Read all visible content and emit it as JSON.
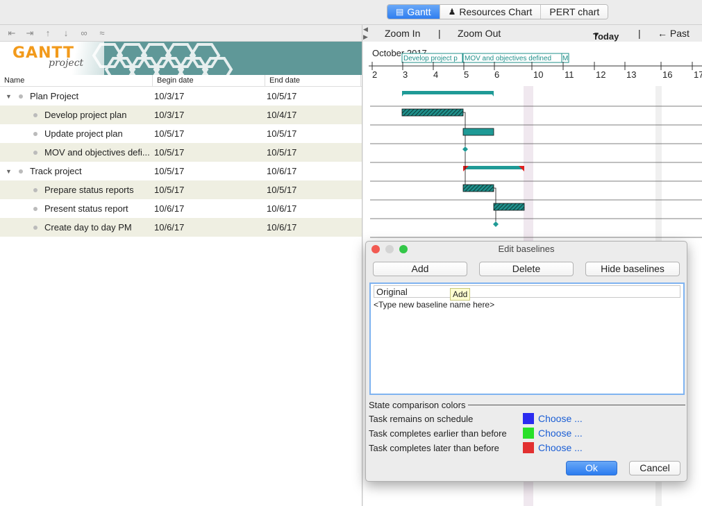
{
  "tabs": [
    {
      "label": "Gantt",
      "icon": "gantt-icon"
    },
    {
      "label": "Resources Chart",
      "icon": "resources-icon"
    },
    {
      "label": "PERT chart",
      "icon": ""
    }
  ],
  "toolbar": {
    "icons": [
      "unindent-icon",
      "indent-icon",
      "move-up-icon",
      "move-down-icon",
      "link-icon",
      "unlink-icon"
    ]
  },
  "logo": {
    "gantt": "GANTT",
    "project": "project"
  },
  "table": {
    "headers": [
      "Name",
      "Begin date",
      "End date"
    ],
    "rows": [
      {
        "name": "Plan Project",
        "begin": "10/3/17",
        "end": "10/5/17",
        "level": 0
      },
      {
        "name": "Develop project plan",
        "begin": "10/3/17",
        "end": "10/4/17",
        "level": 1
      },
      {
        "name": "Update project plan",
        "begin": "10/5/17",
        "end": "10/5/17",
        "level": 1
      },
      {
        "name": "MOV and objectives defi...",
        "begin": "10/5/17",
        "end": "10/5/17",
        "level": 1
      },
      {
        "name": "Track project",
        "begin": "10/5/17",
        "end": "10/6/17",
        "level": 0
      },
      {
        "name": "Prepare status reports",
        "begin": "10/5/17",
        "end": "10/5/17",
        "level": 1
      },
      {
        "name": "Present status report",
        "begin": "10/6/17",
        "end": "10/6/17",
        "level": 1
      },
      {
        "name": "Create day to day PM",
        "begin": "10/6/17",
        "end": "10/6/17",
        "level": 1
      }
    ]
  },
  "gantt": {
    "zoom_in": "Zoom In",
    "separator": "|",
    "zoom_out": "Zoom Out",
    "today": "Today",
    "past": "← Past",
    "month": "October 2017",
    "days": [
      "2",
      "3",
      "4",
      "5",
      "6",
      "10",
      "11",
      "12",
      "13",
      "16",
      "17"
    ],
    "labels": [
      "Develop project p",
      "MOV and objectives defined",
      "M"
    ]
  },
  "dialog": {
    "title": "Edit baselines",
    "add": "Add",
    "delete": "Delete",
    "hide": "Hide baselines",
    "baseline": "Original",
    "new_placeholder": "<Type new baseline name here>",
    "tooltip": "Add",
    "section": "State comparison colors",
    "colors": [
      {
        "label": "Task remains on schedule",
        "color": "#2b2bf0",
        "action": "Choose ..."
      },
      {
        "label": "Task completes earlier than before",
        "color": "#28e028",
        "action": "Choose ..."
      },
      {
        "label": "Task completes later than before",
        "color": "#e23030",
        "action": "Choose ..."
      }
    ],
    "ok": "Ok",
    "cancel": "Cancel"
  }
}
